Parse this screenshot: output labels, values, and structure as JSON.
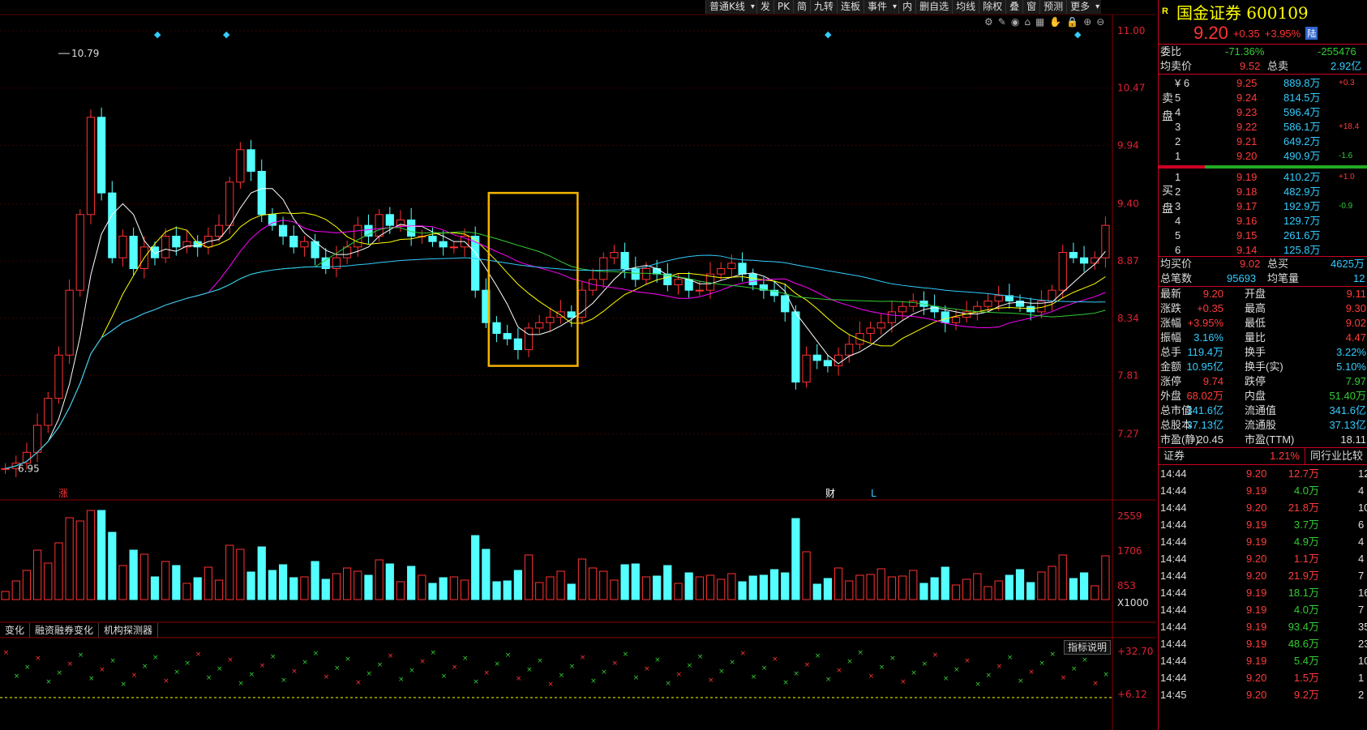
{
  "toolbar": {
    "items": [
      "普通K线",
      "发",
      "PK",
      "简",
      "九转",
      "连板",
      "事件",
      "内",
      "删自选",
      "均线",
      "除权",
      "叠",
      "窗",
      "预测",
      "更多"
    ]
  },
  "chart_data": {
    "type": "candlestick",
    "price_axis": [
      "11.00",
      "10.47",
      "9.94",
      "9.40",
      "8.87",
      "8.34",
      "7.81",
      "7.27"
    ],
    "ylim": [
      6.9,
      11.0
    ],
    "max_label": "10.79",
    "min_label": "6.95",
    "volume_axis": [
      "2559",
      "1706",
      "853",
      "X1000"
    ],
    "indicator_axis": [
      "+32.70",
      "+6.12"
    ],
    "markers": {
      "zhang": "涨",
      "cai": "财",
      "l": "L"
    },
    "highlight_range": [
      0.44,
      0.52
    ],
    "closes": [
      6.95,
      7.0,
      7.1,
      7.35,
      7.6,
      8.0,
      8.6,
      9.3,
      10.2,
      9.5,
      8.9,
      9.1,
      8.8,
      9.0,
      8.9,
      9.1,
      9.0,
      9.05,
      9.0,
      9.1,
      9.2,
      9.6,
      9.9,
      9.7,
      9.3,
      9.2,
      9.1,
      9.0,
      9.05,
      8.9,
      8.8,
      8.9,
      9.0,
      9.2,
      9.1,
      9.3,
      9.2,
      9.25,
      9.1,
      9.1,
      9.05,
      9.0,
      9.0,
      9.1,
      8.6,
      8.3,
      8.2,
      8.15,
      8.05,
      8.25,
      8.3,
      8.35,
      8.4,
      8.35,
      8.6,
      8.7,
      8.9,
      8.95,
      8.8,
      8.7,
      8.8,
      8.75,
      8.65,
      8.7,
      8.6,
      8.6,
      8.75,
      8.8,
      8.85,
      8.75,
      8.65,
      8.6,
      8.55,
      8.4,
      7.75,
      8.0,
      7.95,
      7.9,
      8.0,
      8.1,
      8.2,
      8.25,
      8.3,
      8.4,
      8.45,
      8.5,
      8.45,
      8.4,
      8.3,
      8.35,
      8.4,
      8.45,
      8.5,
      8.55,
      8.5,
      8.45,
      8.4,
      8.5,
      8.6,
      8.95,
      8.9,
      8.85,
      8.9,
      9.2
    ]
  },
  "sub_tabs": [
    "变化",
    "融资融券变化",
    "机构探测器"
  ],
  "indicator_btn": "指标说明",
  "stock": {
    "r": "R",
    "name": "国金证券 600109",
    "price": "9.20",
    "chg": "+0.35",
    "pct": "+3.95%",
    "lu": "陆"
  },
  "weibi": {
    "label": "委比",
    "v1": "-71.36%",
    "v2": "-255476"
  },
  "avg_sell": {
    "l1": "均卖价",
    "v1": "9.52",
    "l2": "总卖",
    "v2": "2.92亿"
  },
  "sell_label": "卖盘",
  "buy_label": "买盘",
  "sells": [
    {
      "lvl": "¥ 6",
      "p": "9.25",
      "v": "889.8万",
      "d": "+0.3"
    },
    {
      "lvl": "5",
      "p": "9.24",
      "v": "814.5万",
      "d": ""
    },
    {
      "lvl": "4",
      "p": "9.23",
      "v": "596.4万",
      "d": ""
    },
    {
      "lvl": "3",
      "p": "9.22",
      "v": "586.1万",
      "d": "+18.4"
    },
    {
      "lvl": "2",
      "p": "9.21",
      "v": "649.2万",
      "d": ""
    },
    {
      "lvl": "1",
      "p": "9.20",
      "v": "490.9万",
      "d": "-1.6"
    }
  ],
  "buys": [
    {
      "lvl": "1",
      "p": "9.19",
      "v": "410.2万",
      "d": "+1.0"
    },
    {
      "lvl": "2",
      "p": "9.18",
      "v": "482.9万",
      "d": ""
    },
    {
      "lvl": "3",
      "p": "9.17",
      "v": "192.9万",
      "d": "-0.9"
    },
    {
      "lvl": "4",
      "p": "9.16",
      "v": "129.7万",
      "d": ""
    },
    {
      "lvl": "5",
      "p": "9.15",
      "v": "261.6万",
      "d": ""
    },
    {
      "lvl": "6",
      "p": "9.14",
      "v": "125.8万",
      "d": ""
    }
  ],
  "avg_buy": {
    "l1": "均买价",
    "v1": "9.02",
    "l2": "总买",
    "v2": "4625万"
  },
  "count": {
    "l1": "总笔数",
    "v1": "95693",
    "l2": "均笔量",
    "v2": "12"
  },
  "stats": [
    {
      "l1": "最新",
      "v1": "9.20",
      "c1": "red",
      "l2": "开盘",
      "v2": "9.11",
      "c2": "red"
    },
    {
      "l1": "涨跌",
      "v1": "+0.35",
      "c1": "red",
      "l2": "最高",
      "v2": "9.30",
      "c2": "red"
    },
    {
      "l1": "涨幅",
      "v1": "+3.95%",
      "c1": "red",
      "l2": "最低",
      "v2": "9.02",
      "c2": "red"
    },
    {
      "l1": "振幅",
      "v1": "3.16%",
      "c1": "cyan",
      "l2": "量比",
      "v2": "4.47",
      "c2": "red"
    },
    {
      "l1": "总手",
      "v1": "119.4万",
      "c1": "cyan",
      "l2": "换手",
      "v2": "3.22%",
      "c2": "cyan"
    },
    {
      "l1": "金额",
      "v1": "10.95亿",
      "c1": "cyan",
      "l2": "换手(实)",
      "v2": "5.10%",
      "c2": "cyan"
    },
    {
      "l1": "涨停",
      "v1": "9.74",
      "c1": "red",
      "l2": "跌停",
      "v2": "7.97",
      "c2": "green"
    },
    {
      "l1": "外盘",
      "v1": "68.02万",
      "c1": "red",
      "l2": "内盘",
      "v2": "51.40万",
      "c2": "green"
    },
    {
      "l1": "总市值",
      "v1": "341.6亿",
      "c1": "cyan",
      "l2": "流通值",
      "v2": "341.6亿",
      "c2": "cyan"
    },
    {
      "l1": "总股本",
      "v1": "37.13亿",
      "c1": "cyan",
      "l2": "流通股",
      "v2": "37.13亿",
      "c2": "cyan"
    },
    {
      "l1": "市盈(静)",
      "v1": "20.45",
      "c1": "white",
      "l2": "市盈(TTM)",
      "v2": "18.11",
      "c2": "white"
    }
  ],
  "sector": {
    "name": "证券",
    "pct": "1.21%",
    "cmp": "同行业比较"
  },
  "ticks": [
    {
      "t": "14:44",
      "p": "9.20",
      "pc": "red",
      "v": "12.7万",
      "vc": "red",
      "n": "12"
    },
    {
      "t": "14:44",
      "p": "9.19",
      "pc": "red",
      "v": "4.0万",
      "vc": "green",
      "n": "4"
    },
    {
      "t": "14:44",
      "p": "9.20",
      "pc": "red",
      "v": "21.8万",
      "vc": "red",
      "n": "10"
    },
    {
      "t": "14:44",
      "p": "9.19",
      "pc": "red",
      "v": "3.7万",
      "vc": "green",
      "n": "6"
    },
    {
      "t": "14:44",
      "p": "9.19",
      "pc": "red",
      "v": "4.9万",
      "vc": "green",
      "n": "4"
    },
    {
      "t": "14:44",
      "p": "9.20",
      "pc": "red",
      "v": "1.1万",
      "vc": "red",
      "n": "4"
    },
    {
      "t": "14:44",
      "p": "9.20",
      "pc": "red",
      "v": "21.9万",
      "vc": "red",
      "n": "7"
    },
    {
      "t": "14:44",
      "p": "9.19",
      "pc": "red",
      "v": "18.1万",
      "vc": "green",
      "n": "16"
    },
    {
      "t": "14:44",
      "p": "9.19",
      "pc": "red",
      "v": "4.0万",
      "vc": "green",
      "n": "7"
    },
    {
      "t": "14:44",
      "p": "9.19",
      "pc": "red",
      "v": "93.4万",
      "vc": "green",
      "n": "35"
    },
    {
      "t": "14:44",
      "p": "9.19",
      "pc": "red",
      "v": "48.6万",
      "vc": "green",
      "n": "23"
    },
    {
      "t": "14:44",
      "p": "9.19",
      "pc": "red",
      "v": "5.4万",
      "vc": "green",
      "n": "10"
    },
    {
      "t": "14:44",
      "p": "9.20",
      "pc": "red",
      "v": "1.5万",
      "vc": "red",
      "n": "1"
    },
    {
      "t": "14:45",
      "p": "9.20",
      "pc": "red",
      "v": "9.2万",
      "vc": "red",
      "n": "2"
    }
  ]
}
